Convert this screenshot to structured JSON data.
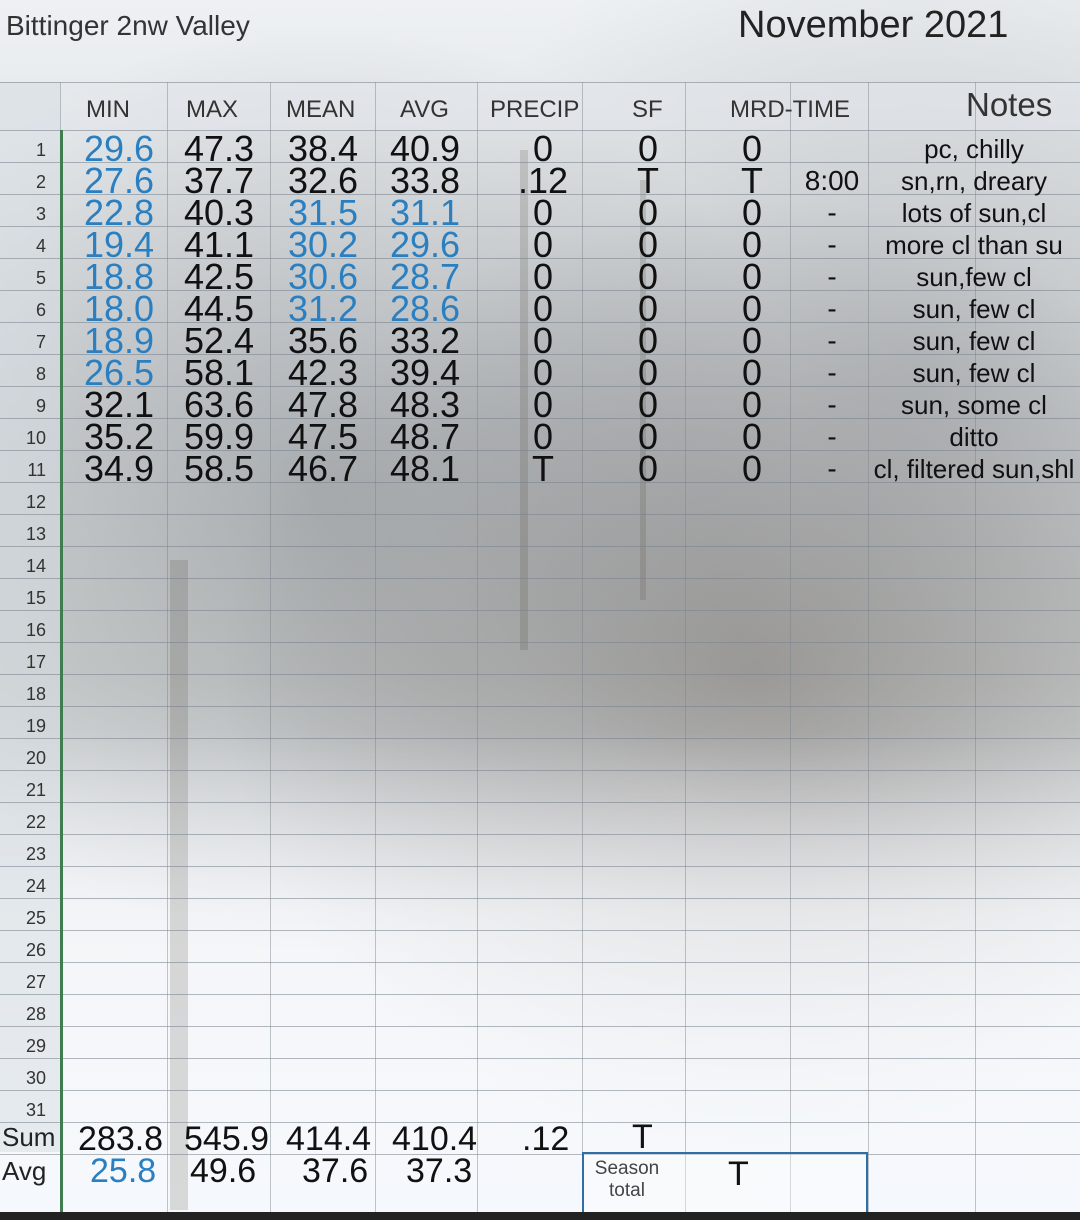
{
  "sheet": {
    "station": "Bittinger 2nw Valley",
    "month": "November 2021",
    "columns": [
      "MIN",
      "MAX",
      "MEAN",
      "AVG",
      "PRECIP",
      "SF",
      "MRD-TIME"
    ],
    "notes_header": "Notes",
    "row_numbers": [
      "1",
      "2",
      "3",
      "4",
      "5",
      "6",
      "7",
      "8",
      "9",
      "10",
      "11",
      "12",
      "13",
      "14",
      "15",
      "16",
      "17",
      "18",
      "19",
      "20",
      "21",
      "22",
      "23",
      "24",
      "25",
      "26",
      "27",
      "28",
      "29",
      "30",
      "31"
    ],
    "rows": [
      {
        "min": "29.6",
        "max": "47.3",
        "mean": "38.4",
        "avg": "40.9",
        "precip": "0",
        "sf": "0",
        "mrd": "0",
        "time": "",
        "note": "pc, chilly"
      },
      {
        "min": "27.6",
        "max": "37.7",
        "mean": "32.6",
        "avg": "33.8",
        "precip": ".12",
        "sf": "T",
        "mrd": "T",
        "time": "8:00",
        "note": "sn,rn, dreary"
      },
      {
        "min": "22.8",
        "max": "40.3",
        "mean": "31.5",
        "avg": "31.1",
        "precip": "0",
        "sf": "0",
        "mrd": "0",
        "time": "-",
        "note": "lots of sun,cl"
      },
      {
        "min": "19.4",
        "max": "41.1",
        "mean": "30.2",
        "avg": "29.6",
        "precip": "0",
        "sf": "0",
        "mrd": "0",
        "time": "-",
        "note": "more cl than su"
      },
      {
        "min": "18.8",
        "max": "42.5",
        "mean": "30.6",
        "avg": "28.7",
        "precip": "0",
        "sf": "0",
        "mrd": "0",
        "time": "-",
        "note": "sun,few cl"
      },
      {
        "min": "18.0",
        "max": "44.5",
        "mean": "31.2",
        "avg": "28.6",
        "precip": "0",
        "sf": "0",
        "mrd": "0",
        "time": "-",
        "note": "sun, few cl"
      },
      {
        "min": "18.9",
        "max": "52.4",
        "mean": "35.6",
        "avg": "33.2",
        "precip": "0",
        "sf": "0",
        "mrd": "0",
        "time": "-",
        "note": "sun, few cl"
      },
      {
        "min": "26.5",
        "max": "58.1",
        "mean": "42.3",
        "avg": "39.4",
        "precip": "0",
        "sf": "0",
        "mrd": "0",
        "time": "-",
        "note": "sun, few cl"
      },
      {
        "min": "32.1",
        "max": "63.6",
        "mean": "47.8",
        "avg": "48.3",
        "precip": "0",
        "sf": "0",
        "mrd": "0",
        "time": "-",
        "note": "sun, some cl"
      },
      {
        "min": "35.2",
        "max": "59.9",
        "mean": "47.5",
        "avg": "48.7",
        "precip": "0",
        "sf": "0",
        "mrd": "0",
        "time": "-",
        "note": "ditto"
      },
      {
        "min": "34.9",
        "max": "58.5",
        "mean": "46.7",
        "avg": "48.1",
        "precip": "T",
        "sf": "0",
        "mrd": "0",
        "time": "-",
        "note": "cl, filtered sun,shl"
      }
    ],
    "blue_cells": {
      "min": [
        true,
        true,
        true,
        true,
        true,
        true,
        true,
        true,
        false,
        false,
        false
      ],
      "mean": [
        false,
        false,
        true,
        true,
        true,
        true,
        false,
        false,
        false,
        false,
        false
      ],
      "avg": [
        false,
        false,
        true,
        true,
        true,
        true,
        false,
        false,
        false,
        false,
        false
      ]
    },
    "footer": {
      "sum_label": "Sum",
      "avg_label": "Avg",
      "sum": {
        "min": "283.8",
        "max": "545.9",
        "mean": "414.4",
        "avg": "410.4",
        "precip": ".12",
        "sf": "T"
      },
      "avg": {
        "min": "25.8",
        "max": "49.6",
        "mean": "37.6",
        "avg": "37.3"
      },
      "season_label": "Season total",
      "season_total": "T"
    },
    "colors": {
      "blue": "#2a7fc1",
      "green_bar": "#3f7d50",
      "season_border": "#2f6fa8"
    }
  }
}
